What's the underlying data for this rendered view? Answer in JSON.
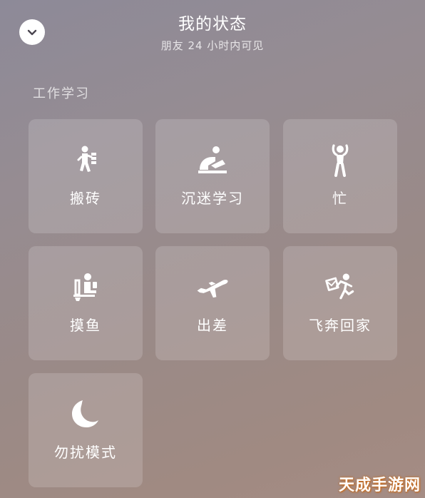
{
  "header": {
    "title": "我的状态",
    "subtitle": "朋友 24 小时内可见"
  },
  "section": {
    "label": "工作学习"
  },
  "tiles": [
    {
      "label": "搬砖",
      "icon": "carrying-bricks-icon"
    },
    {
      "label": "沉迷学习",
      "icon": "studying-icon"
    },
    {
      "label": "忙",
      "icon": "busy-person-icon"
    },
    {
      "label": "摸鱼",
      "icon": "slacking-icon"
    },
    {
      "label": "出差",
      "icon": "airplane-icon"
    },
    {
      "label": "飞奔回家",
      "icon": "running-home-icon"
    },
    {
      "label": "勿扰模式",
      "icon": "moon-icon"
    }
  ],
  "watermark": "天成手游网",
  "colors": {
    "tile_background": "rgba(255,255,255,0.16)",
    "text": "#ffffff",
    "watermark_outline": "#c96a1a"
  }
}
